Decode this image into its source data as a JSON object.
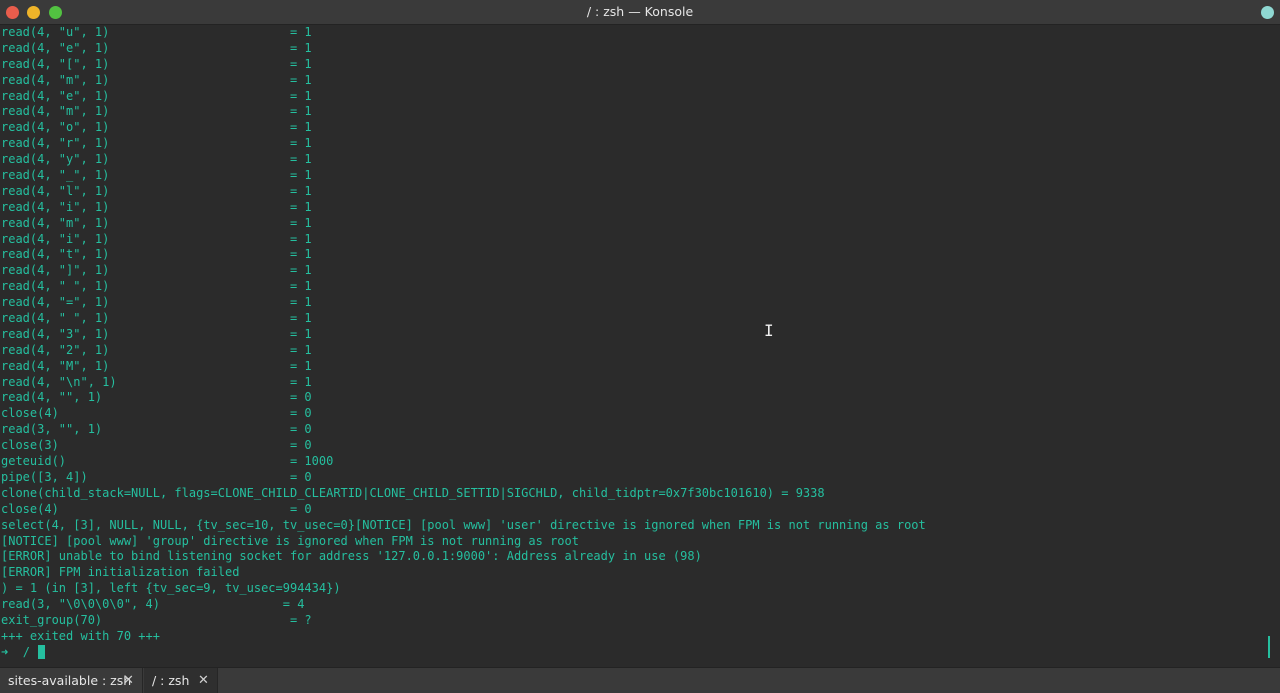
{
  "window": {
    "title": "/ : zsh — Konsole"
  },
  "terminal": {
    "lines": [
      "read(4, \"u\", 1)                         = 1",
      "read(4, \"e\", 1)                         = 1",
      "read(4, \"[\", 1)                         = 1",
      "read(4, \"m\", 1)                         = 1",
      "read(4, \"e\", 1)                         = 1",
      "read(4, \"m\", 1)                         = 1",
      "read(4, \"o\", 1)                         = 1",
      "read(4, \"r\", 1)                         = 1",
      "read(4, \"y\", 1)                         = 1",
      "read(4, \"_\", 1)                         = 1",
      "read(4, \"l\", 1)                         = 1",
      "read(4, \"i\", 1)                         = 1",
      "read(4, \"m\", 1)                         = 1",
      "read(4, \"i\", 1)                         = 1",
      "read(4, \"t\", 1)                         = 1",
      "read(4, \"]\", 1)                         = 1",
      "read(4, \" \", 1)                         = 1",
      "read(4, \"=\", 1)                         = 1",
      "read(4, \" \", 1)                         = 1",
      "read(4, \"3\", 1)                         = 1",
      "read(4, \"2\", 1)                         = 1",
      "read(4, \"M\", 1)                         = 1",
      "read(4, \"\\n\", 1)                        = 1",
      "read(4, \"\", 1)                          = 0",
      "close(4)                                = 0",
      "read(3, \"\", 1)                          = 0",
      "close(3)                                = 0",
      "geteuid()                               = 1000",
      "pipe([3, 4])                            = 0",
      "clone(child_stack=NULL, flags=CLONE_CHILD_CLEARTID|CLONE_CHILD_SETTID|SIGCHLD, child_tidptr=0x7f30bc101610) = 9338",
      "close(4)                                = 0",
      "select(4, [3], NULL, NULL, {tv_sec=10, tv_usec=0}[NOTICE] [pool www] 'user' directive is ignored when FPM is not running as root",
      "[NOTICE] [pool www] 'group' directive is ignored when FPM is not running as root",
      "[ERROR] unable to bind listening socket for address '127.0.0.1:9000': Address already in use (98)",
      "[ERROR] FPM initialization failed",
      ") = 1 (in [3], left {tv_sec=9, tv_usec=994434})",
      "read(3, \"\\0\\0\\0\\0\", 4)                 = 4",
      "exit_group(70)                          = ?",
      "+++ exited with 70 +++"
    ],
    "prompt_arrow": "➜",
    "prompt_path": "/"
  },
  "tabs": [
    {
      "label": "sites-available : zsh",
      "close": "✕"
    },
    {
      "label": "/ : zsh",
      "close": "✕"
    }
  ],
  "colors": {
    "terminal_text": "#25bf9f",
    "background": "#2b2b2b"
  }
}
